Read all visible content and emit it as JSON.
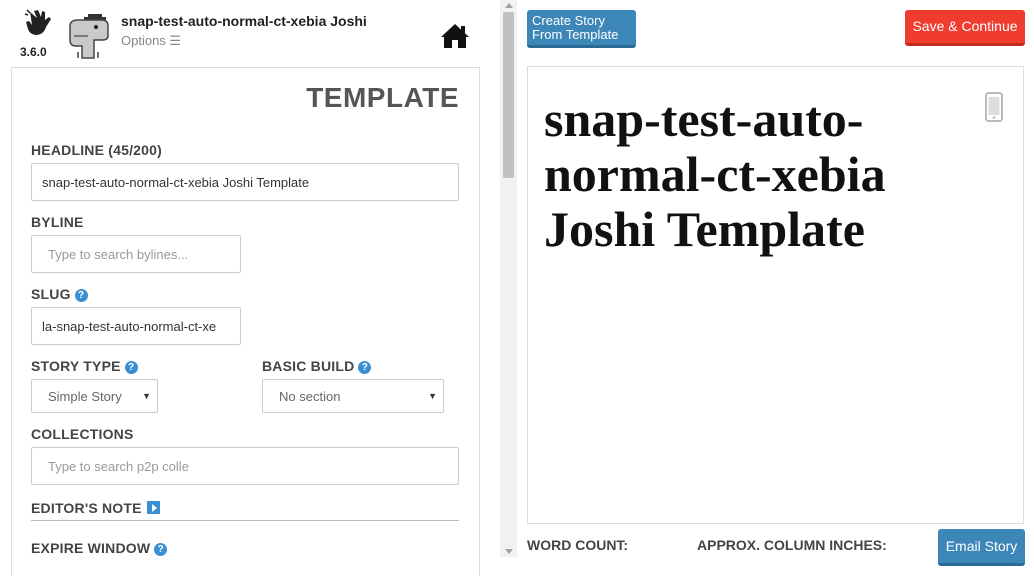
{
  "app": {
    "version": "3.6.0"
  },
  "header": {
    "title": "snap-test-auto-normal-ct-xebia Joshi",
    "options_label": "Options ☰"
  },
  "form": {
    "heading": "TEMPLATE",
    "headline": {
      "label": "HEADLINE (45/200)",
      "value": "snap-test-auto-normal-ct-xebia Joshi Template"
    },
    "byline": {
      "label": "BYLINE",
      "placeholder": "Type to search bylines..."
    },
    "slug": {
      "label": "SLUG",
      "value": "la-snap-test-auto-normal-ct-xe"
    },
    "story_type": {
      "label": "STORY TYPE",
      "value": "Simple Story"
    },
    "basic_build": {
      "label": "BASIC BUILD",
      "value": "No section"
    },
    "collections": {
      "label": "COLLECTIONS",
      "placeholder": "Type to search p2p colle"
    },
    "editors_note": {
      "label": "EDITOR'S NOTE"
    },
    "expire_window": {
      "label": "EXPIRE WINDOW"
    }
  },
  "toolbar": {
    "create_from_template": "Create Story\nFrom Template",
    "save_continue": "Save & Continue",
    "email_story": "Email Story"
  },
  "preview": {
    "headline": "snap-test-auto-normal-ct-xebia Joshi Template"
  },
  "footer": {
    "word_count_label": "WORD COUNT:",
    "column_inches_label": "APPROX. COLUMN INCHES:"
  },
  "icons": {
    "logo": "snap-hand-icon",
    "avatar": "dino-avatar-icon",
    "home": "home-icon",
    "help": "question-circle-icon",
    "play": "play-square-icon",
    "phone": "mobile-phone-icon"
  },
  "colors": {
    "primary_button": "#3d86b8",
    "save_button": "#f03b2f",
    "help_icon": "#3a8fd3"
  }
}
